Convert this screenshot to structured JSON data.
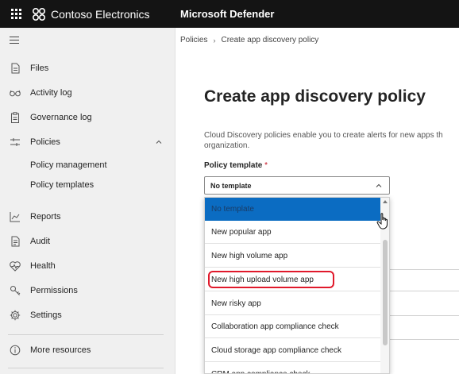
{
  "topbar": {
    "brand": "Contoso Electronics",
    "product": "Microsoft Defender",
    "waffle_icon": "app-launcher-icon",
    "background": "#141414"
  },
  "sidebar": {
    "items": [
      {
        "label": "Files",
        "icon": "files-icon"
      },
      {
        "label": "Activity log",
        "icon": "glasses-icon"
      },
      {
        "label": "Governance log",
        "icon": "clipboard-icon"
      },
      {
        "label": "Policies",
        "icon": "sliders-icon",
        "expanded": true
      },
      {
        "label": "Policy management"
      },
      {
        "label": "Policy templates"
      },
      {
        "label": "Reports",
        "icon": "chart-line-icon"
      },
      {
        "label": "Audit",
        "icon": "document-icon"
      },
      {
        "label": "Health",
        "icon": "heart-pulse-icon"
      },
      {
        "label": "Permissions",
        "icon": "key-icon"
      },
      {
        "label": "Settings",
        "icon": "gear-icon"
      },
      {
        "label": "More resources",
        "icon": "info-icon"
      }
    ]
  },
  "main": {
    "breadcrumb": [
      "Policies",
      "Create app discovery policy"
    ],
    "title": "Create app discovery policy",
    "description_line1": "Cloud Discovery policies enable you to create alerts for new apps th",
    "description_line2": "organization.",
    "template_label": "Policy template",
    "required_mark": "*",
    "template_value": "No template",
    "options": [
      "No template",
      "New popular app",
      "New high volume app",
      "New high upload volume app",
      "New risky app",
      "Collaboration app compliance check",
      "Cloud storage app compliance check",
      "CRM app compliance check"
    ],
    "selected_option": "No template",
    "highlighted_option": "New high upload volume app",
    "colors": {
      "selected_bg": "#0b6cc2",
      "highlight_ring": "#e0192b",
      "required": "#c50f1f"
    }
  }
}
